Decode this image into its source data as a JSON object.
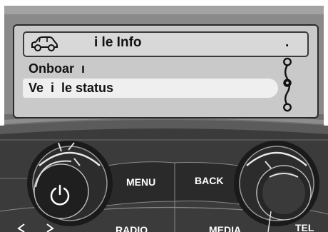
{
  "display": {
    "header": {
      "title": "i le Info",
      "trailing_mark": ".",
      "icon": "car-icon"
    },
    "menu_items": [
      {
        "label": "Onboar  ı",
        "selected": false
      },
      {
        "label": "Ve  i  le status",
        "selected": true
      }
    ],
    "scroll_icon": "scroll-rail-icon"
  },
  "console": {
    "buttons": {
      "menu": "MENU",
      "back": "BACK",
      "radio": "RADIO",
      "media": "MEDIA",
      "tel": "TEL"
    },
    "left_knob_icon": "power-icon",
    "nav_icons": [
      "arrow-left-icon",
      "arrow-right-icon"
    ]
  },
  "colors": {
    "display_bg": "#c9c9c9",
    "highlight": "#efefef",
    "bezel": "#6f6f6f",
    "console": "#333333"
  }
}
